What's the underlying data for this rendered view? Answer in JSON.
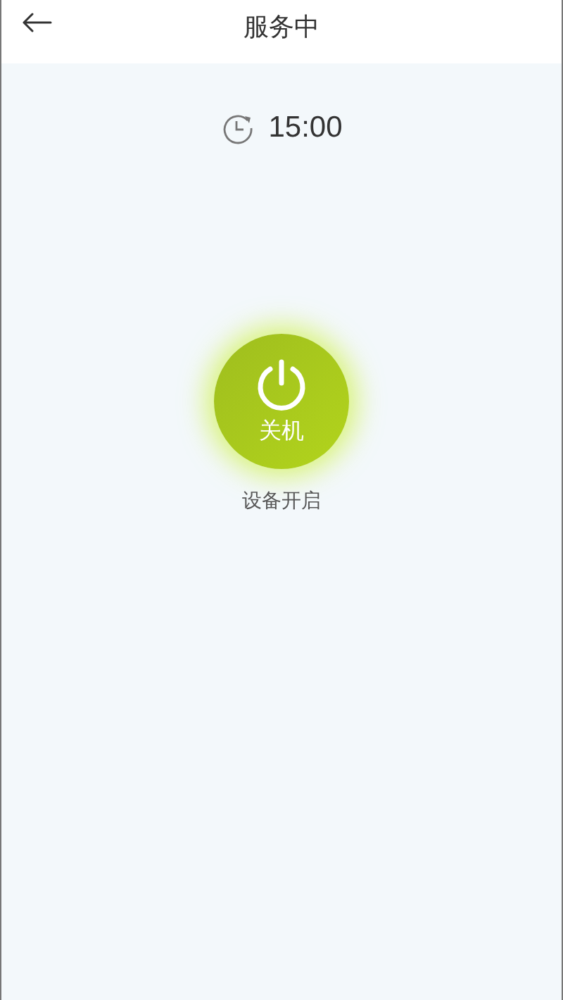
{
  "header": {
    "title": "服务中"
  },
  "timer": {
    "time": "15:00"
  },
  "power_button": {
    "label": "关机"
  },
  "status": "设备开启"
}
